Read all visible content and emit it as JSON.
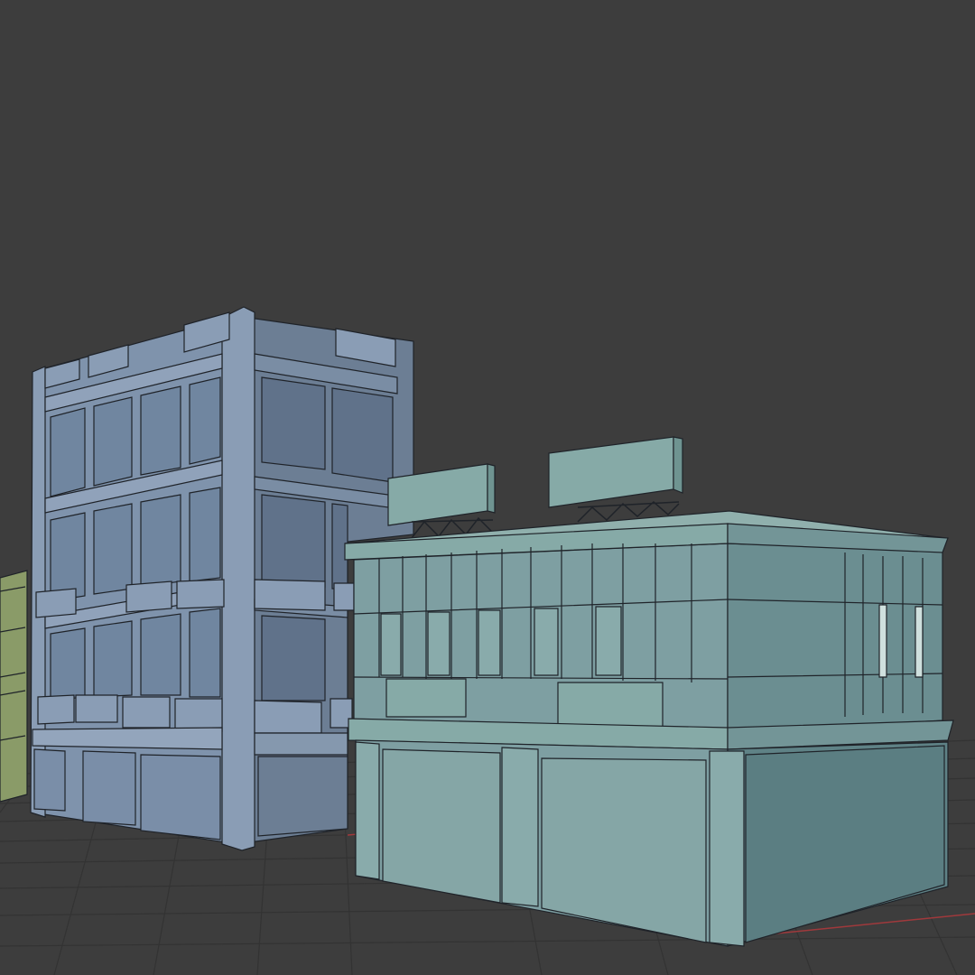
{
  "viewport": {
    "mode": "3d-viewport",
    "shading": "solid",
    "overlays": [
      "wireframe",
      "floor-grid"
    ],
    "colors": {
      "background": "#3d3d3d",
      "grid": "#333333",
      "x_axis": "#a0393c",
      "wire": "#1f2329"
    }
  },
  "objects": [
    {
      "name": "left-building-partial",
      "color": "#8a9b68"
    },
    {
      "name": "tall-office-building",
      "color": "#7f93ac"
    },
    {
      "name": "two-story-shop-building",
      "color": "#7e9fa2"
    },
    {
      "name": "rooftop-billboard-left",
      "color": "#86aaa7"
    },
    {
      "name": "rooftop-billboard-right",
      "color": "#86aaa7"
    }
  ]
}
